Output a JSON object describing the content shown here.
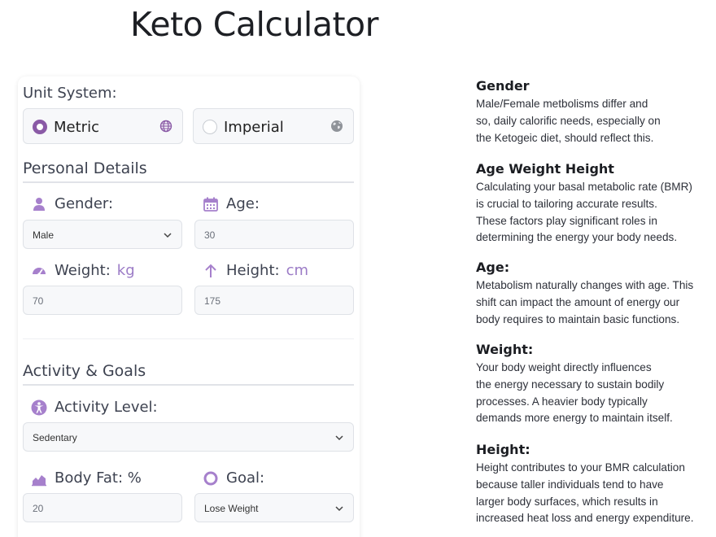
{
  "page": {
    "title": "Keto Calculator"
  },
  "form": {
    "unit_system_label": "Unit System:",
    "units": {
      "metric": "Metric",
      "imperial": "Imperial",
      "selected": "metric"
    },
    "personal_details_heading": "Personal Details",
    "gender": {
      "label": "Gender:",
      "value": "Male"
    },
    "age": {
      "label": "Age:",
      "value": "30"
    },
    "weight": {
      "label": "Weight:",
      "unit": "kg",
      "value": "70"
    },
    "height": {
      "label": "Height:",
      "unit": "cm",
      "value": "175"
    },
    "activity_goals_heading": "Activity & Goals",
    "activity": {
      "label": "Activity Level:",
      "value": "Sedentary"
    },
    "body_fat": {
      "label": "Body Fat: %",
      "value": "20"
    },
    "goal": {
      "label": "Goal:",
      "value": "Lose Weight"
    }
  },
  "info": [
    {
      "title": "Gender",
      "text": "Male/Female metbolisms differ and\nso, daily calorific needs, especially on\nthe Ketogeic diet, should reflect this."
    },
    {
      "title": "Age Weight Height",
      "text": "Calculating your basal metabolic rate (BMR)\nis crucial to tailoring accurate results.\nThese factors play significant roles in\ndetermining the energy your body needs."
    },
    {
      "title": "Age:",
      "text": "Metabolism naturally changes with age. This\nshift can impact the amount of energy our\nbody requires to maintain basic functions."
    },
    {
      "title": "Weight:",
      "text": "Your body weight directly influences\nthe energy necessary to sustain bodily\nprocesses. A heavier body typically\ndemands more energy to maintain itself."
    },
    {
      "title": "Height:",
      "text": "Height contributes to your BMR calculation\nbecause taller individuals tend to have\nlarger body surfaces, which results in\nincreased heat loss and energy expenditure."
    }
  ],
  "colors": {
    "accent": "#8a5aa6",
    "accent_light": "#9b7bc6",
    "input_bg": "#f7f8fa",
    "border": "#dfe2e7"
  },
  "icons": {
    "metric": "globe-icon",
    "imperial": "earth-icon",
    "gender": "user-icon",
    "age": "calendar-icon",
    "weight": "gauge-icon",
    "height": "arrow-up-icon",
    "activity": "accessibility-icon",
    "body_fat": "chart-area-icon",
    "goal": "circle-icon",
    "select": "chevron-down-icon"
  }
}
